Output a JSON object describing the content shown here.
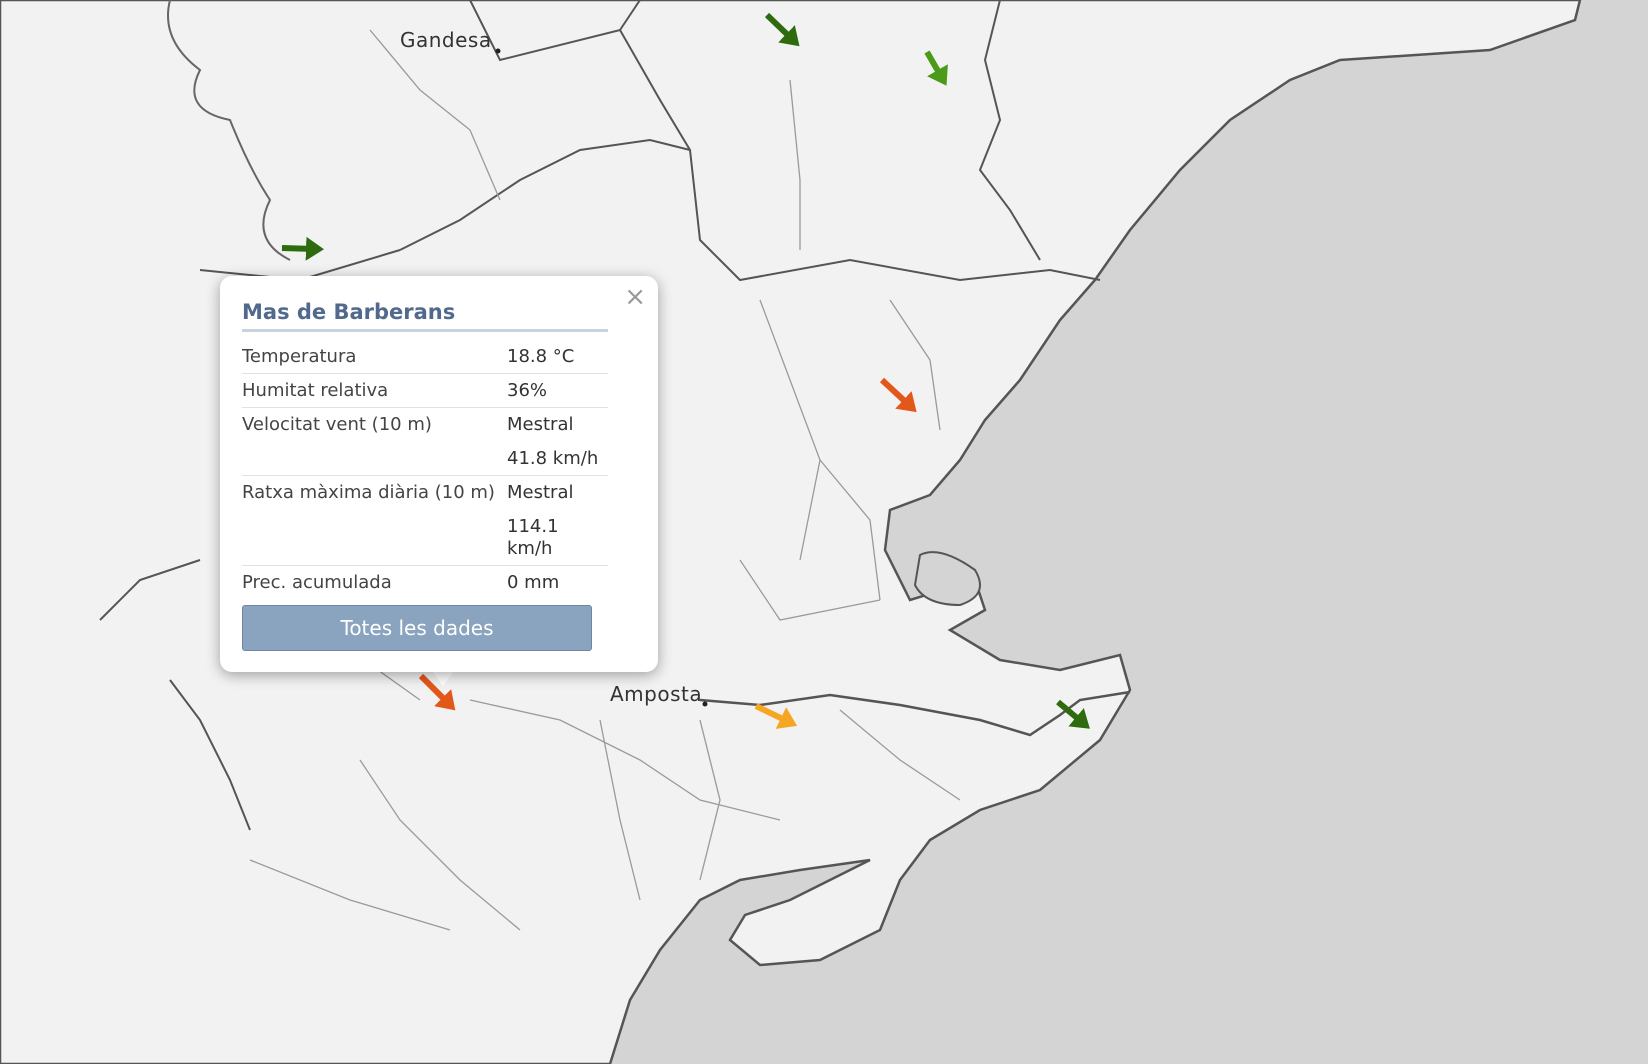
{
  "map": {
    "land_color": "#f2f2f2",
    "sea_color": "#d4d4d4",
    "border_color": "#555555",
    "places": [
      {
        "name": "Gandesa"
      },
      {
        "name": "Amposta"
      }
    ],
    "wind_arrows": [
      {
        "color": "#2e6b0f",
        "direction": "southeast"
      },
      {
        "color": "#4c9a1a",
        "direction": "south-southeast"
      },
      {
        "color": "#2e6b0f",
        "direction": "east"
      },
      {
        "color": "#e2571a",
        "direction": "southeast"
      },
      {
        "color": "#e2571a",
        "direction": "southeast"
      },
      {
        "color": "#f5a623",
        "direction": "east-southeast"
      },
      {
        "color": "#2e6b0f",
        "direction": "southeast"
      }
    ]
  },
  "popup": {
    "title": "Mas de Barberans",
    "close_icon": "×",
    "rows": [
      {
        "label": "Temperatura",
        "values": [
          "18.8 °C"
        ]
      },
      {
        "label": "Humitat relativa",
        "values": [
          "36%"
        ]
      },
      {
        "label": "Velocitat vent (10 m)",
        "values": [
          "Mestral",
          "41.8 km/h"
        ]
      },
      {
        "label": "Ratxa màxima diària (10 m)",
        "values": [
          "Mestral",
          "114.1 km/h"
        ]
      },
      {
        "label": "Prec. acumulada",
        "values": [
          "0 mm"
        ]
      }
    ],
    "button_label": "Totes les dades"
  }
}
